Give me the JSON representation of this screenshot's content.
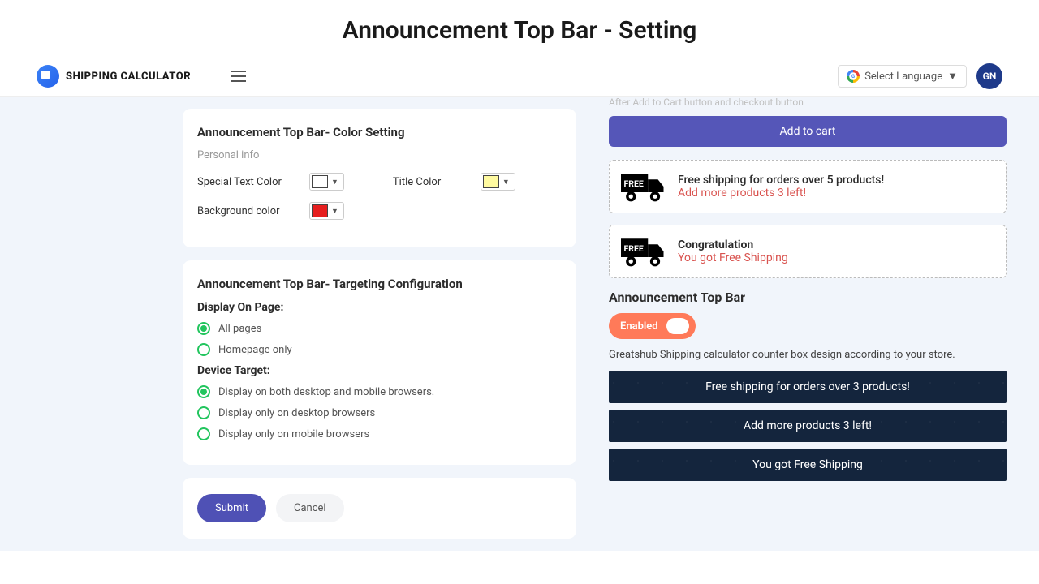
{
  "page_title": "Announcement Top Bar - Setting",
  "header": {
    "logo_text": "SHIPPING CALCULATOR",
    "language_label": "Select Language",
    "avatar_initials": "GN"
  },
  "color_setting": {
    "title": "Announcement Top Bar- Color Setting",
    "subtitle": "Personal info",
    "special_text_label": "Special Text Color",
    "special_text_color": "#ffffff",
    "title_color_label": "Title Color",
    "title_color": "#fffaa0",
    "bg_label": "Background color",
    "bg_color": "#e61e1e"
  },
  "targeting": {
    "title": "Announcement Top Bar- Targeting Configuration",
    "display_label": "Display On Page:",
    "opt_all": "All pages",
    "opt_home": "Homepage only",
    "device_label": "Device Target:",
    "opt_both": "Display on both desktop and mobile browsers.",
    "opt_desktop": "Display only on desktop browsers",
    "opt_mobile": "Display only on mobile browsers"
  },
  "buttons": {
    "submit": "Submit",
    "cancel": "Cancel"
  },
  "preview": {
    "ghost": "After Add to Cart button and checkout button",
    "add_to_cart": "Add to cart",
    "promo1_line1": "Free shipping for orders over 5 products!",
    "promo1_line2": "Add more products 3 left!",
    "promo2_line1": "Congratulation",
    "promo2_line2": "You got Free Shipping",
    "section_title": "Announcement Top Bar",
    "toggle_label": "Enabled",
    "desc": "Greatshub Shipping calculator counter box design according to your store.",
    "bar1": "Free shipping for orders over 3 products!",
    "bar2": "Add more products 3 left!",
    "bar3": "You got Free Shipping"
  }
}
